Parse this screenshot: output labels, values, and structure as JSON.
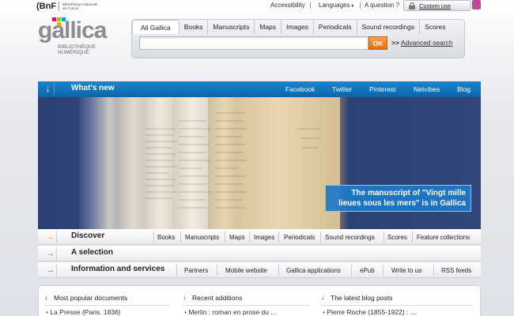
{
  "header": {
    "bnf_mark": "(BnF",
    "bnf_sub": "Bibliothèque nationale de France",
    "accessibility": "Accessibility",
    "languages": "Languages",
    "question": "A question ?",
    "custom_use": "Custom use"
  },
  "logo": {
    "word": "gallica",
    "sub": "BIBLIOTHÈQUE NUMÉRIQUE"
  },
  "search": {
    "tabs": [
      "All Gallica",
      "Books",
      "Manuscripts",
      "Maps",
      "Images",
      "Periodicals",
      "Sound recordings",
      "Scores"
    ],
    "input_value": "",
    "ok_label": "OK",
    "advanced_prefix": ">>",
    "advanced_label": "Advanced search"
  },
  "whats_new": {
    "arrow": "↓",
    "title": "What's new",
    "social": [
      "Facebook",
      "Twitter",
      "Pinterest",
      "Netvibes",
      "Blog"
    ],
    "caption": "The manuscript of \"Vingt mille lieues sous les mers\" is in Gallica"
  },
  "discover": {
    "label": "Discover",
    "links": [
      "Books",
      "Manuscripts",
      "Maps",
      "Images",
      "Periodicals",
      "Sound recordings",
      "Scores",
      "Feature collections"
    ]
  },
  "selection": {
    "label": "A selection"
  },
  "info": {
    "label": "Information and services",
    "links": [
      "Partners",
      "Mobile website",
      "Gallica applications",
      "ePub",
      "Write to us",
      "RSS feeds"
    ]
  },
  "bottom": {
    "popular_title": "Most popular documents",
    "popular_item": "La Presse (Paris. 1836)",
    "recent_title": "Recent additions",
    "recent_item": "Merlin : roman en prose du ...",
    "blog_title": "The latest blog posts",
    "blog_item": "Pierre Roche (1855-1922) : ..."
  },
  "colors": {
    "accent_blue": "#0b6fb8",
    "ok_orange": "#e9781a",
    "discover_arrow": "#f0a030",
    "selection_arrow": "#8a5bc4",
    "info_arrow": "#e04a2a"
  }
}
